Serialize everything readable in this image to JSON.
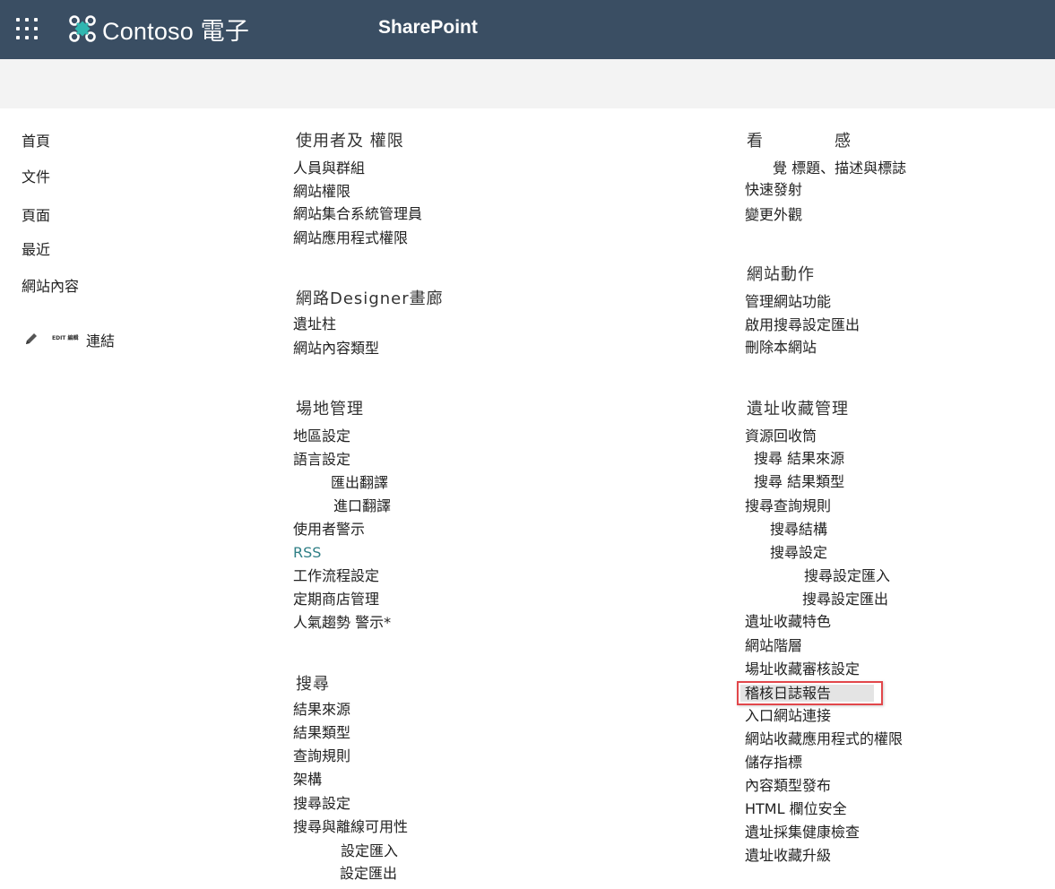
{
  "header": {
    "brand_name": "Contoso 電子",
    "app_name": "SharePoint",
    "waffle_icon": "app-launcher-icon",
    "logo_icon": "contoso-logo-icon",
    "background_color": "#3a4e63"
  },
  "left_nav": {
    "items": [
      "首頁",
      "文件",
      "頁面",
      "最近",
      "網站內容"
    ],
    "edit_tag": "EDIT 編輯",
    "edit_link": "連結",
    "edit_icon": "pencil-icon"
  },
  "sections": {
    "users_permissions": {
      "heading": "使用者及 權限",
      "items": [
        "人員與群組",
        "網站權限",
        "網站集合系統管理員",
        "網站應用程式權限"
      ]
    },
    "designer": {
      "heading": "網路Designer畫廊",
      "items": [
        "遺址柱",
        "網站內容類型"
      ]
    },
    "site_admin": {
      "heading": "場地管理",
      "items": [
        "地區設定",
        "語言設定",
        "匯出翻譯",
        "進口翻譯",
        "使用者警示",
        "RSS",
        "工作流程設定",
        "定期商店管理",
        "人氣趨勢 警示*"
      ]
    },
    "search": {
      "heading": "搜尋",
      "items": [
        "結果來源",
        "結果類型",
        "查詢規則",
        "架構",
        "搜尋設定",
        "搜尋與離線可用性",
        "設定匯入",
        "設定匯出"
      ]
    },
    "look_feel": {
      "heading_1": "看",
      "heading_2": "感",
      "items": [
        "覺 標題、描述與標誌",
        "快速發射",
        "變更外觀"
      ]
    },
    "site_actions": {
      "heading": "網站動作",
      "items": [
        "管理網站功能",
        "啟用搜尋設定匯出",
        "刪除本網站"
      ]
    },
    "site_collection_admin": {
      "heading": "遺址收藏管理",
      "items": [
        "資源回收筒",
        "搜尋 結果來源",
        "搜尋 結果類型",
        "搜尋查詢規則",
        "搜尋結構",
        "搜尋設定",
        "搜尋設定匯入",
        "搜尋設定匯出",
        "遺址收藏特色",
        "網站階層",
        "場址收藏審核設定",
        "稽核日誌報告",
        "入口網站連接",
        "網站收藏應用程式的權限",
        "儲存指標",
        "內容類型發布",
        "HTML 欄位安全",
        "遺址採集健康檢查",
        "遺址收藏升級"
      ],
      "selected_item": "稽核日誌報告",
      "selected_border_color": "#e2474b"
    }
  },
  "colors": {
    "rss_link": "#2f7f86",
    "subbar": "#f3f3f3"
  }
}
